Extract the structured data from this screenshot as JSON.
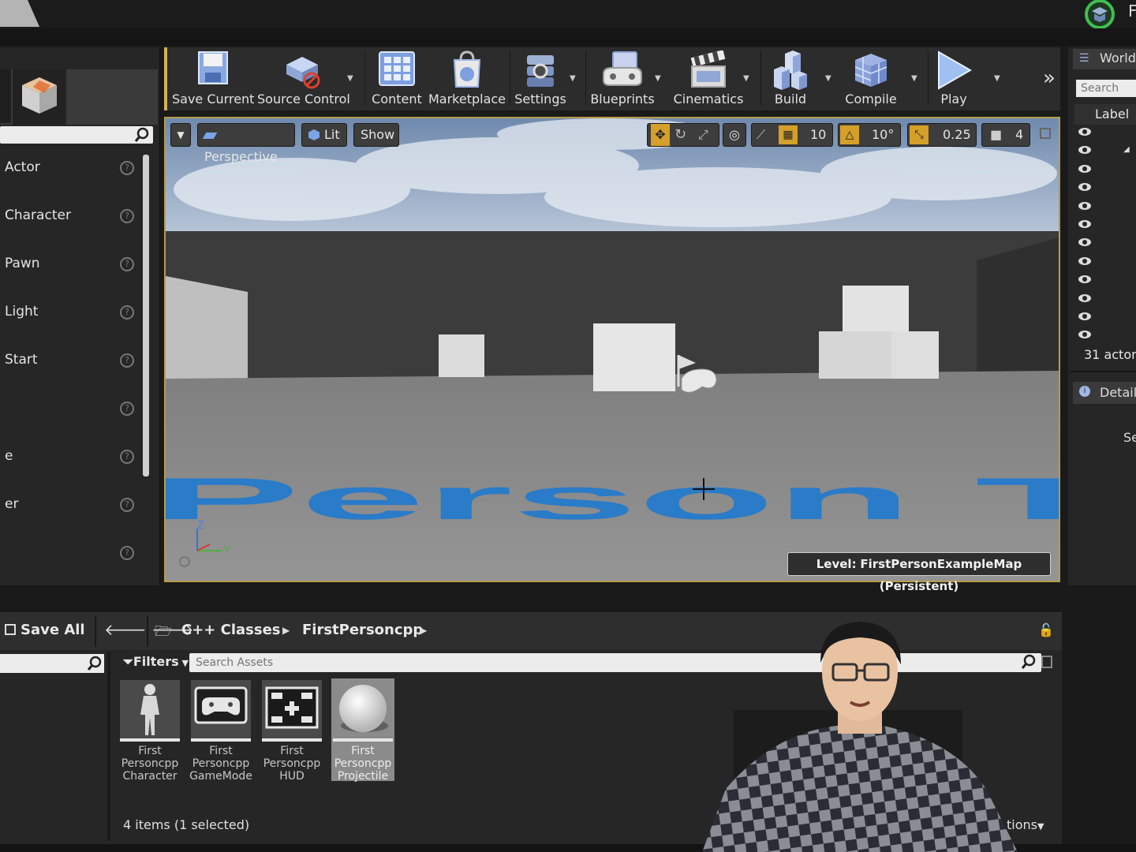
{
  "top": {
    "corner_letter": "F"
  },
  "place_actors": {
    "items": [
      "Actor",
      "Character",
      "Pawn",
      "Light",
      "Start",
      "",
      "e",
      "er",
      ""
    ]
  },
  "toolbar": {
    "save_current": "Save Current",
    "source_control": "Source Control",
    "content": "Content",
    "marketplace": "Marketplace",
    "settings": "Settings",
    "blueprints": "Blueprints",
    "cinematics": "Cinematics",
    "build": "Build",
    "compile": "Compile",
    "play": "Play"
  },
  "viewport": {
    "perspective": "Perspective",
    "lit": "Lit",
    "show": "Show",
    "grid_snap": "10",
    "rotation_snap": "10°",
    "scale_snap": "0.25",
    "camera_speed": "4",
    "level_label": "Level:",
    "level_name": "FirstPersonExampleMap (Persistent)",
    "axis_z": "Z",
    "axis_y": "Y",
    "floor_text": "Person T"
  },
  "world_outliner": {
    "tab": "World",
    "search_placeholder": "Search",
    "label_header": "Label",
    "actor_count": "31 actors",
    "details_tab": "Details",
    "details_search": "Se"
  },
  "content_browser": {
    "save_all": "Save All",
    "breadcrumb": [
      "C++ Classes",
      "FirstPersoncpp"
    ],
    "filters": "Filters",
    "search_placeholder": "Search Assets",
    "assets": [
      {
        "name": "First Personcpp Character"
      },
      {
        "name": "First Personcpp GameMode"
      },
      {
        "name": "First Personcpp HUD"
      },
      {
        "name": "First Personcpp Projectile"
      }
    ],
    "items_count": "4 items (1 selected)",
    "view_options": "tions"
  },
  "colors": {
    "accent_gold": "#d4b25a",
    "floor_text_blue": "#2a7bc8",
    "panel_bg": "#262626"
  }
}
